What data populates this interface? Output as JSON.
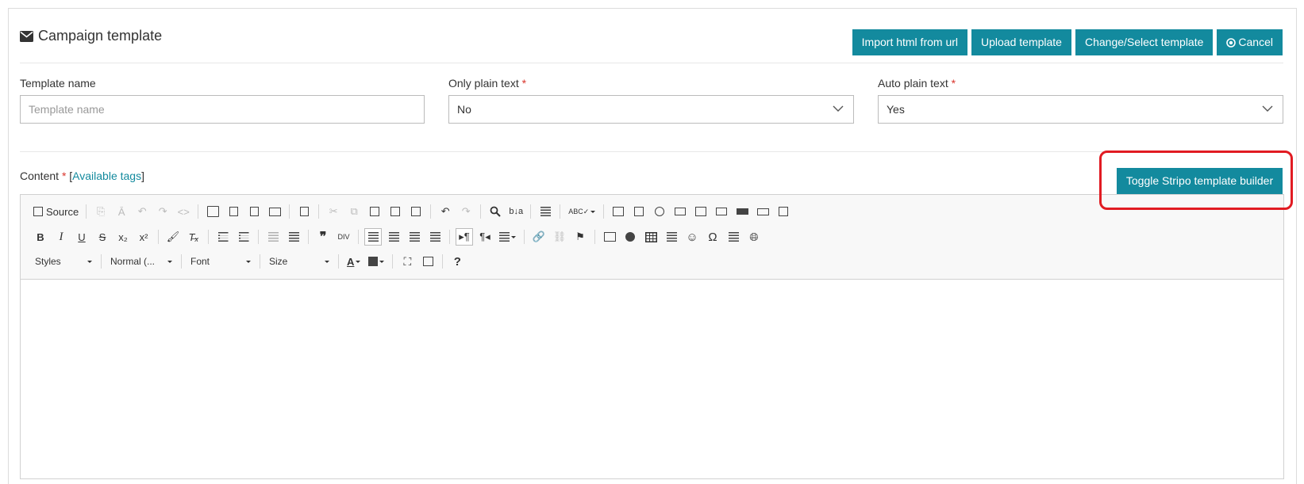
{
  "header": {
    "title": "Campaign template",
    "buttons": {
      "import_html": "Import html from url",
      "upload": "Upload template",
      "change_select": "Change/Select template",
      "cancel": "Cancel"
    }
  },
  "form": {
    "template_name": {
      "label": "Template name",
      "placeholder": "Template name",
      "value": ""
    },
    "only_plain_text": {
      "label": "Only plain text",
      "required_mark": "*",
      "value": "No"
    },
    "auto_plain_text": {
      "label": "Auto plain text",
      "required_mark": "*",
      "value": "Yes"
    }
  },
  "content": {
    "label": "Content",
    "required_mark": "*",
    "bracket_open": "[",
    "available_tags": "Available tags",
    "bracket_close": "]",
    "toggle_button": "Toggle Stripo template builder"
  },
  "toolbar": {
    "source": "Source",
    "styles": "Styles",
    "format": "Normal (...",
    "font": "Font",
    "size": "Size",
    "help": "?"
  },
  "colors": {
    "accent": "#138a9e",
    "highlight": "#e11b22",
    "required": "#d9342b"
  }
}
